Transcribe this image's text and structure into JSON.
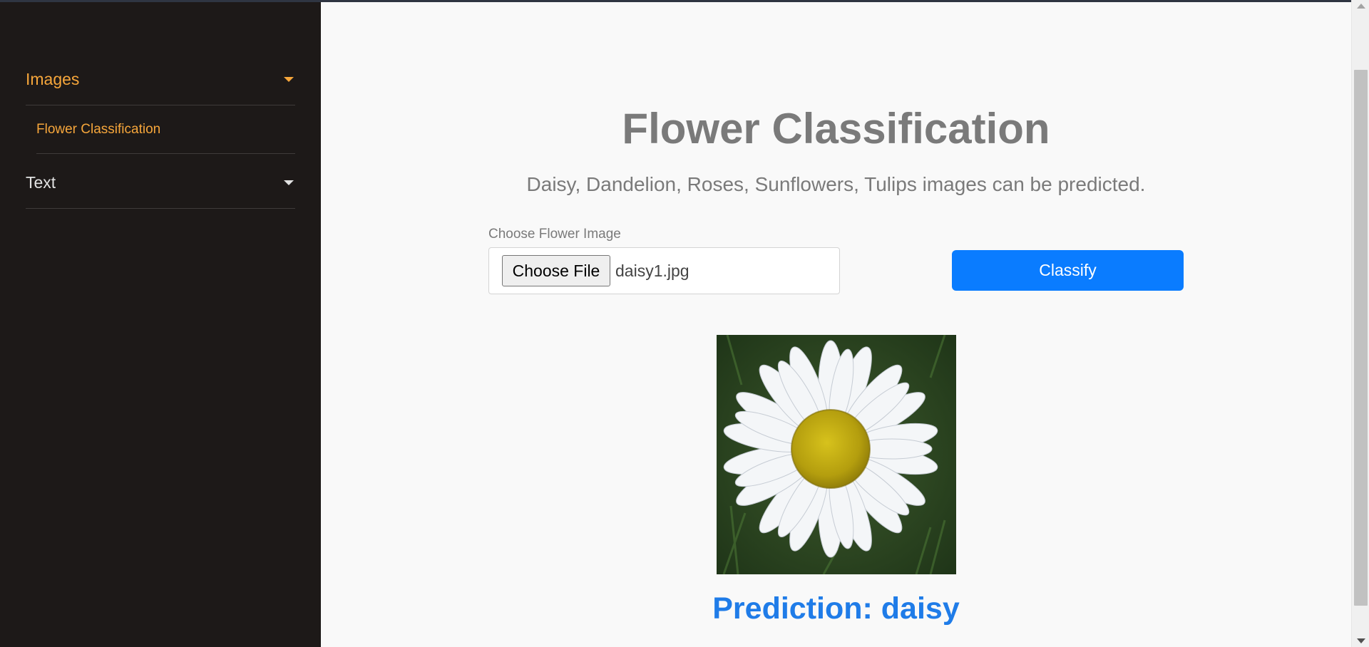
{
  "sidebar": {
    "groups": [
      {
        "label": "Images",
        "items": [
          {
            "label": "Flower Classification"
          }
        ]
      },
      {
        "label": "Text",
        "items": []
      }
    ]
  },
  "main": {
    "title": "Flower Classification",
    "subtitle": "Daisy, Dandelion, Roses, Sunflowers, Tulips images can be predicted.",
    "file_input": {
      "label": "Choose Flower Image",
      "button_label": "Choose File",
      "file_name": "daisy1.jpg"
    },
    "classify_label": "Classify",
    "prediction": "Prediction: daisy"
  },
  "colors": {
    "sidebar_bg": "#1d1918",
    "accent": "#f6a63b",
    "primary": "#0a7cff",
    "prediction": "#1f7ce8"
  },
  "icons": {
    "group_toggle": "caret-down-icon"
  }
}
